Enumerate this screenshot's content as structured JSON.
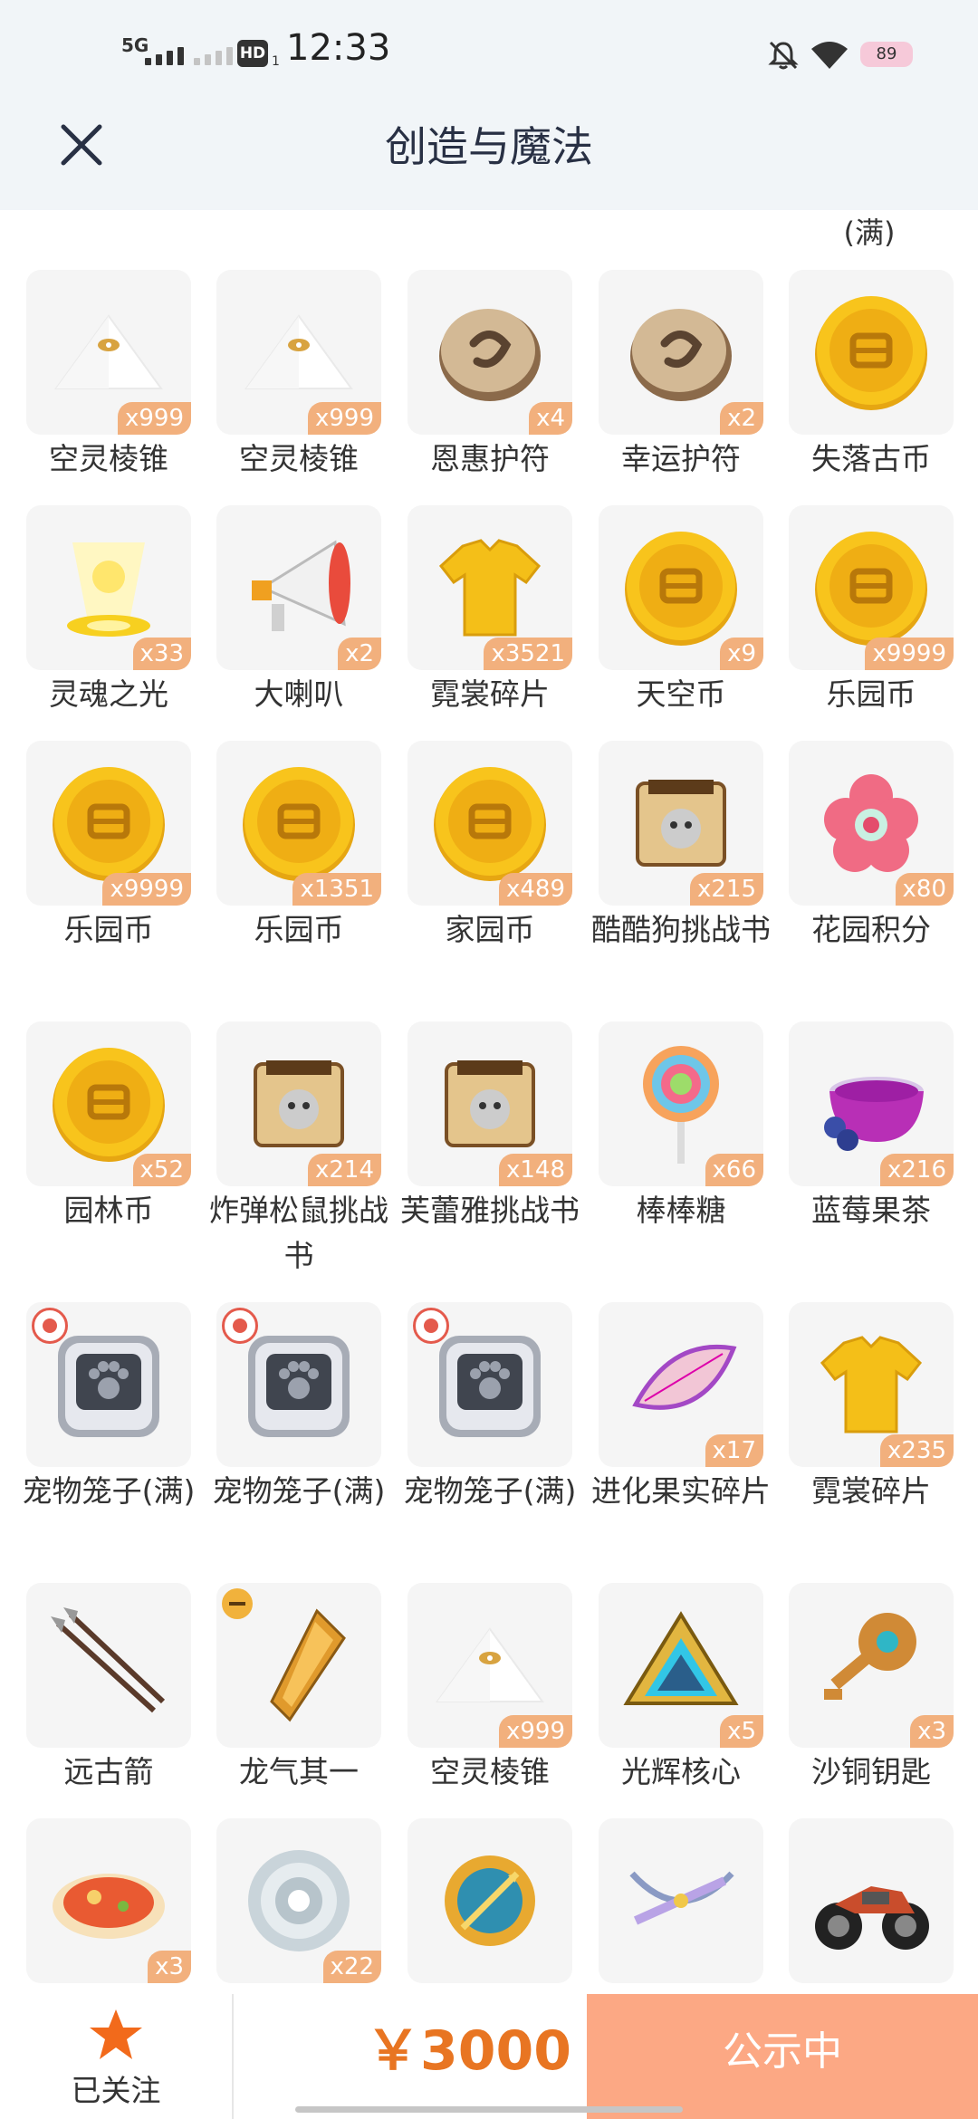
{
  "status_bar": {
    "network": "5G",
    "hd": "HD",
    "hd_sub": "1",
    "time": "12:33",
    "battery": "89"
  },
  "nav": {
    "title": "创造与魔法"
  },
  "partial_label": "(满)",
  "items": [
    {
      "label": "空灵棱锥",
      "count": "x999",
      "icon": "pyramid-icon"
    },
    {
      "label": "空灵棱锥",
      "count": "x999",
      "icon": "pyramid-icon"
    },
    {
      "label": "恩惠护符",
      "count": "x4",
      "icon": "stone-amulet-icon"
    },
    {
      "label": "幸运护符",
      "count": "x2",
      "icon": "stone-amulet-icon"
    },
    {
      "label": "失落古币",
      "count": "",
      "icon": "gold-coin-icon"
    },
    {
      "label": "灵魂之光",
      "count": "x33",
      "icon": "soul-light-icon"
    },
    {
      "label": "大喇叭",
      "count": "x2",
      "icon": "megaphone-icon"
    },
    {
      "label": "霓裳碎片",
      "count": "x3521",
      "icon": "shirt-icon"
    },
    {
      "label": "天空币",
      "count": "x9",
      "icon": "gold-coin-icon"
    },
    {
      "label": "乐园币",
      "count": "x9999",
      "icon": "gold-coin-icon"
    },
    {
      "label": "乐园币",
      "count": "x9999",
      "icon": "gold-coin-icon"
    },
    {
      "label": "乐园币",
      "count": "x1351",
      "icon": "gold-coin-icon"
    },
    {
      "label": "家园币",
      "count": "x489",
      "icon": "gold-coin-icon"
    },
    {
      "label": "酷酷狗挑战书",
      "count": "x215",
      "icon": "wanted-scroll-icon"
    },
    {
      "label": "花园积分",
      "count": "x80",
      "icon": "flower-icon"
    },
    {
      "label": "园林币",
      "count": "x52",
      "icon": "gold-coin-icon"
    },
    {
      "label": "炸弹松鼠挑战书",
      "count": "x214",
      "icon": "wanted-scroll-icon"
    },
    {
      "label": "芙蕾雅挑战书",
      "count": "x148",
      "icon": "wanted-scroll-icon"
    },
    {
      "label": "棒棒糖",
      "count": "x66",
      "icon": "lollipop-icon"
    },
    {
      "label": "蓝莓果茶",
      "count": "x216",
      "icon": "tea-cup-icon"
    },
    {
      "label": "宠物笼子(满)",
      "count": "",
      "icon": "pet-cage-icon"
    },
    {
      "label": "宠物笼子(满)",
      "count": "",
      "icon": "pet-cage-icon"
    },
    {
      "label": "宠物笼子(满)",
      "count": "",
      "icon": "pet-cage-icon"
    },
    {
      "label": "进化果实碎片",
      "count": "x17",
      "icon": "fruit-slice-icon"
    },
    {
      "label": "霓裳碎片",
      "count": "x235",
      "icon": "shirt-icon"
    },
    {
      "label": "远古箭",
      "count": "",
      "icon": "arrows-icon"
    },
    {
      "label": "龙气其一",
      "count": "",
      "icon": "dragon-shard-icon"
    },
    {
      "label": "空灵棱锥",
      "count": "x999",
      "icon": "pyramid-icon"
    },
    {
      "label": "光辉核心",
      "count": "x5",
      "icon": "triangle-core-icon"
    },
    {
      "label": "沙铜钥匙",
      "count": "x3",
      "icon": "key-icon"
    },
    {
      "label": "",
      "count": "x3",
      "icon": "soup-bowl-icon"
    },
    {
      "label": "",
      "count": "x22",
      "icon": "white-flower-icon"
    },
    {
      "label": "",
      "count": "",
      "icon": "emblem-icon"
    },
    {
      "label": "",
      "count": "",
      "icon": "crossbow-icon"
    },
    {
      "label": "",
      "count": "",
      "icon": "motorcycle-icon"
    }
  ],
  "bottom_bar": {
    "follow_label": "已关注",
    "price": "￥3000",
    "cta_label": "公示中"
  }
}
